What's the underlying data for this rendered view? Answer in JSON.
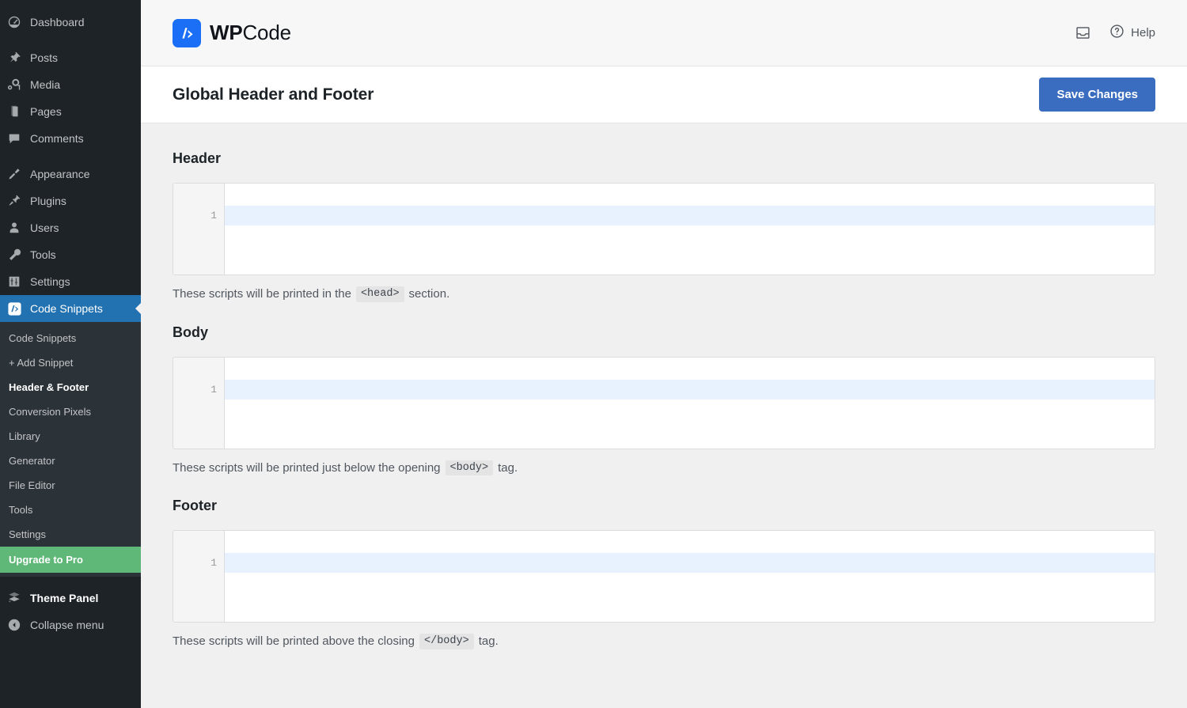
{
  "sidebar": {
    "top_items": [
      {
        "label": "Dashboard",
        "icon": "dashboard-icon",
        "current": false
      },
      {
        "label": "Posts",
        "icon": "pin-icon",
        "current": false
      },
      {
        "label": "Media",
        "icon": "media-icon",
        "current": false
      },
      {
        "label": "Pages",
        "icon": "pages-icon",
        "current": false
      },
      {
        "label": "Comments",
        "icon": "comments-icon",
        "current": false
      },
      {
        "label": "Appearance",
        "icon": "appearance-icon",
        "current": false
      },
      {
        "label": "Plugins",
        "icon": "plugins-icon",
        "current": false
      },
      {
        "label": "Users",
        "icon": "users-icon",
        "current": false
      },
      {
        "label": "Tools",
        "icon": "tools-icon",
        "current": false
      },
      {
        "label": "Settings",
        "icon": "settings-icon",
        "current": false
      },
      {
        "label": "Code Snippets",
        "icon": "code-snippets-icon",
        "current": true
      }
    ],
    "submenu": [
      {
        "label": "Code Snippets",
        "current": false
      },
      {
        "label": "+ Add Snippet",
        "current": false
      },
      {
        "label": "Header & Footer",
        "current": true
      },
      {
        "label": "Conversion Pixels",
        "current": false
      },
      {
        "label": "Library",
        "current": false
      },
      {
        "label": "Generator",
        "current": false
      },
      {
        "label": "File Editor",
        "current": false
      },
      {
        "label": "Tools",
        "current": false
      },
      {
        "label": "Settings",
        "current": false
      }
    ],
    "upgrade": {
      "label": "Upgrade to Pro"
    },
    "bottom_items": [
      {
        "label": "Theme Panel",
        "icon": "theme-panel-icon"
      },
      {
        "label": "Collapse menu",
        "icon": "collapse-icon"
      }
    ],
    "colors": {
      "background": "#1d2327",
      "submenu_background": "#2c3338",
      "current_background": "#2271b1",
      "upgrade_background": "#5fb878"
    }
  },
  "topbar": {
    "logo_bold": "WP",
    "logo_light": "Code",
    "logo_glyph": "/>",
    "logo_color": "#1b6ff7",
    "inbox_icon": "inbox-icon",
    "help_icon": "question-circle-icon",
    "help_label": "Help"
  },
  "titlebar": {
    "title": "Global Header and Footer",
    "save_label": "Save Changes",
    "save_color": "#3a6cbf"
  },
  "sections": [
    {
      "title": "Header",
      "editor": {
        "line_number": "1",
        "value": ""
      },
      "description_before": "These scripts will be printed in the",
      "description_code": "<head>",
      "description_after": "section."
    },
    {
      "title": "Body",
      "editor": {
        "line_number": "1",
        "value": ""
      },
      "description_before": "These scripts will be printed just below the opening",
      "description_code": "<body>",
      "description_after": "tag."
    },
    {
      "title": "Footer",
      "editor": {
        "line_number": "1",
        "value": ""
      },
      "description_before": "These scripts will be printed above the closing",
      "description_code": "</body>",
      "description_after": "tag."
    }
  ]
}
